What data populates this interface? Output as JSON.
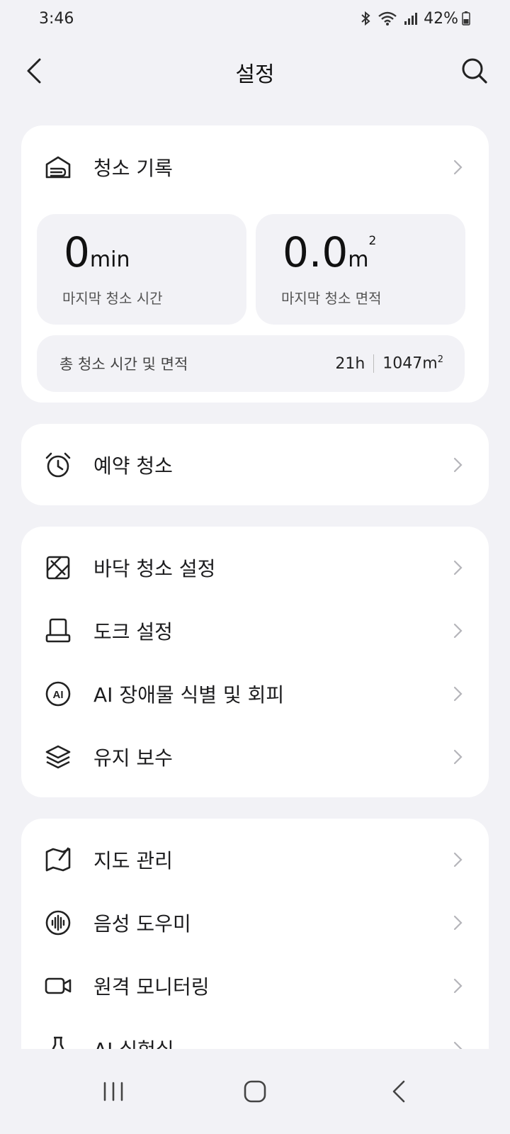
{
  "status_bar": {
    "time": "3:46",
    "battery": "42%"
  },
  "header": {
    "title": "설정"
  },
  "cleaning_record": {
    "label": "청소 기록",
    "last_time_value": "0",
    "last_time_unit": "min",
    "last_time_label": "마지막 청소 시간",
    "last_area_value": "0.0",
    "last_area_unit": "m",
    "last_area_sup": "2",
    "last_area_label": "마지막 청소 면적",
    "total_label": "총 청소 시간 및 면적",
    "total_time": "21h",
    "total_area": "1047m",
    "total_area_sup": "2"
  },
  "schedule": {
    "label": "예약 청소"
  },
  "group_settings": [
    {
      "label": "바닥 청소 설정",
      "icon": "floor-icon"
    },
    {
      "label": "도크 설정",
      "icon": "dock-icon"
    },
    {
      "label": "AI 장애물 식별 및 회피",
      "icon": "ai-icon"
    },
    {
      "label": "유지 보수",
      "icon": "layers-icon"
    }
  ],
  "group_more": [
    {
      "label": "지도 관리",
      "icon": "map-icon"
    },
    {
      "label": "음성 도우미",
      "icon": "voice-icon"
    },
    {
      "label": "원격 모니터링",
      "icon": "camera-icon"
    },
    {
      "label": "AI 실험실",
      "icon": "flask-icon"
    }
  ]
}
